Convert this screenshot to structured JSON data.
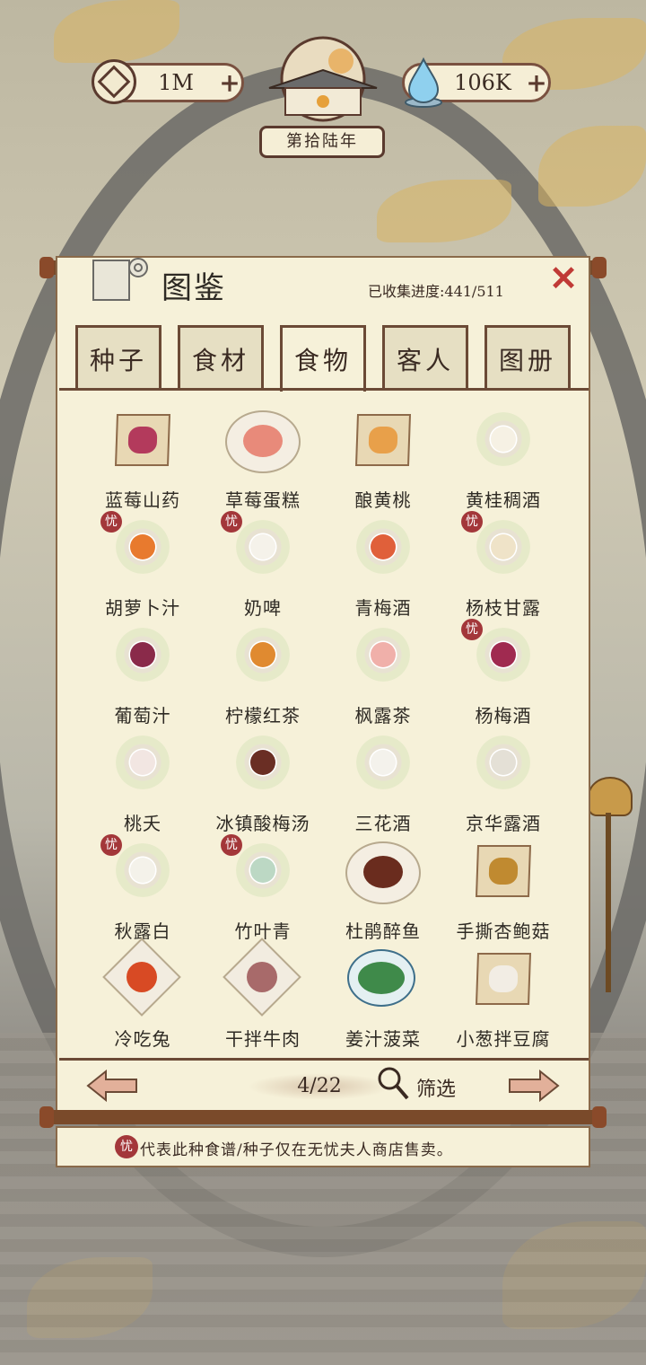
{
  "hud": {
    "coins": "1M",
    "water": "106K",
    "year": "第拾陆年"
  },
  "panel": {
    "title": "图鉴",
    "progress": "已收集进度:441/511"
  },
  "tabs": [
    "种子",
    "食材",
    "食物",
    "客人",
    "图册"
  ],
  "active_tab": "食物",
  "items": [
    {
      "name": "蓝莓山药",
      "badge": false,
      "style": "square",
      "color": "#b33a5c"
    },
    {
      "name": "草莓蛋糕",
      "badge": false,
      "style": "plate",
      "color": "#e88a7a"
    },
    {
      "name": "酿黄桃",
      "badge": false,
      "style": "square",
      "color": "#e8a04a"
    },
    {
      "name": "黄桂稠酒",
      "badge": false,
      "style": "dish",
      "color": "#f6f1e4"
    },
    {
      "name": "胡萝卜汁",
      "badge": true,
      "style": "dish",
      "color": "#e87a2e"
    },
    {
      "name": "奶啤",
      "badge": true,
      "style": "dish",
      "color": "#f5f2ea"
    },
    {
      "name": "青梅酒",
      "badge": false,
      "style": "dish",
      "color": "#e0603a"
    },
    {
      "name": "杨枝甘露",
      "badge": true,
      "style": "dish",
      "color": "#efe3c8"
    },
    {
      "name": "葡萄汁",
      "badge": false,
      "style": "dish",
      "color": "#8a2a4a"
    },
    {
      "name": "柠檬红茶",
      "badge": false,
      "style": "dish",
      "color": "#e08a30"
    },
    {
      "name": "枫露茶",
      "badge": false,
      "style": "dish",
      "color": "#f0b0aa"
    },
    {
      "name": "杨梅酒",
      "badge": true,
      "style": "dish",
      "color": "#a02a50"
    },
    {
      "name": "桃夭",
      "badge": false,
      "style": "dish",
      "color": "#f2e6e2"
    },
    {
      "name": "冰镇酸梅汤",
      "badge": false,
      "style": "dish",
      "color": "#6a2e24"
    },
    {
      "name": "三花酒",
      "badge": false,
      "style": "dish",
      "color": "#f4f2ec"
    },
    {
      "name": "京华露酒",
      "badge": false,
      "style": "dish",
      "color": "#e4e0d6"
    },
    {
      "name": "秋露白",
      "badge": true,
      "style": "dish",
      "color": "#f4f2ea"
    },
    {
      "name": "竹叶青",
      "badge": true,
      "style": "dish",
      "color": "#bcd8c4"
    },
    {
      "name": "杜鹃醉鱼",
      "badge": false,
      "style": "plate",
      "color": "#6a2c1e"
    },
    {
      "name": "手撕杏鲍菇",
      "badge": false,
      "style": "square",
      "color": "#c08a30"
    },
    {
      "name": "冷吃兔",
      "badge": false,
      "style": "diamond",
      "color": "#d84a24"
    },
    {
      "name": "干拌牛肉",
      "badge": false,
      "style": "diamond",
      "color": "#a86a6a"
    },
    {
      "name": "姜汁菠菜",
      "badge": false,
      "style": "bowl",
      "color": "#3f8a4a"
    },
    {
      "name": "小葱拌豆腐",
      "badge": false,
      "style": "square",
      "color": "#f2ede4"
    }
  ],
  "badge_glyph": "忧",
  "pagination": {
    "page": "4/22",
    "filter_label": "筛选"
  },
  "notice": {
    "glyph": "忧",
    "text": "代表此种食谱/种子仅在无忧夫人商店售卖。"
  },
  "colors": {
    "panel": "#f6f1d9",
    "border": "#6b4a36",
    "close": "#c03a36",
    "badge": "#a3373a"
  },
  "icons": {
    "coin": "coin-icon",
    "water": "water-drop-icon",
    "close": "close-icon",
    "prev": "arrow-left-icon",
    "next": "arrow-right-icon",
    "filter": "magnifier-icon"
  }
}
